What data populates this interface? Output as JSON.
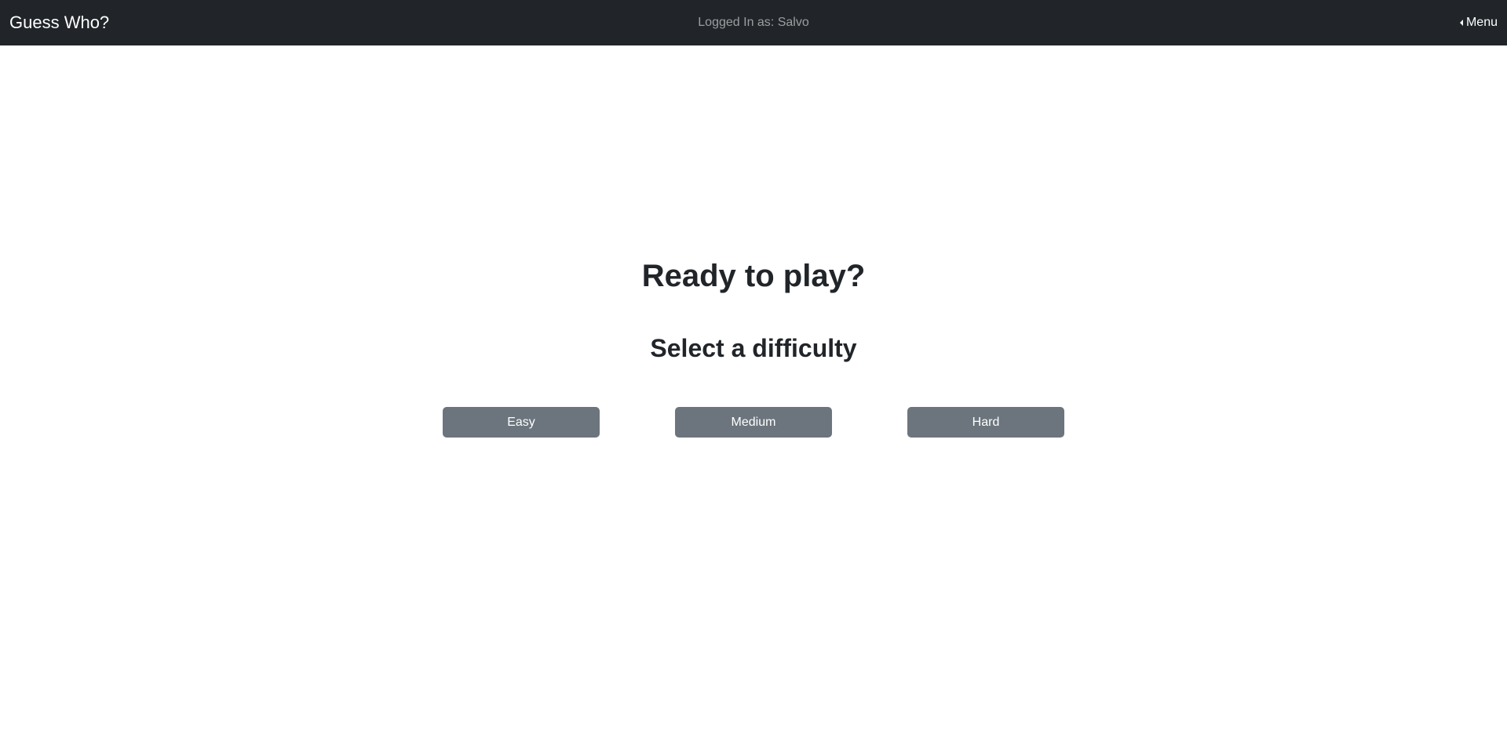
{
  "navbar": {
    "brand": "Guess Who?",
    "user_status": "Logged In as: Salvo",
    "menu_label": "Menu",
    "menu_icon": "caret-left-icon",
    "background_color": "#212529"
  },
  "main": {
    "headline": "Ready to play?",
    "subheadline": "Select a difficulty",
    "difficulties": [
      {
        "label": "Easy"
      },
      {
        "label": "Medium"
      },
      {
        "label": "Hard"
      }
    ],
    "button_color": "#6c757d"
  }
}
